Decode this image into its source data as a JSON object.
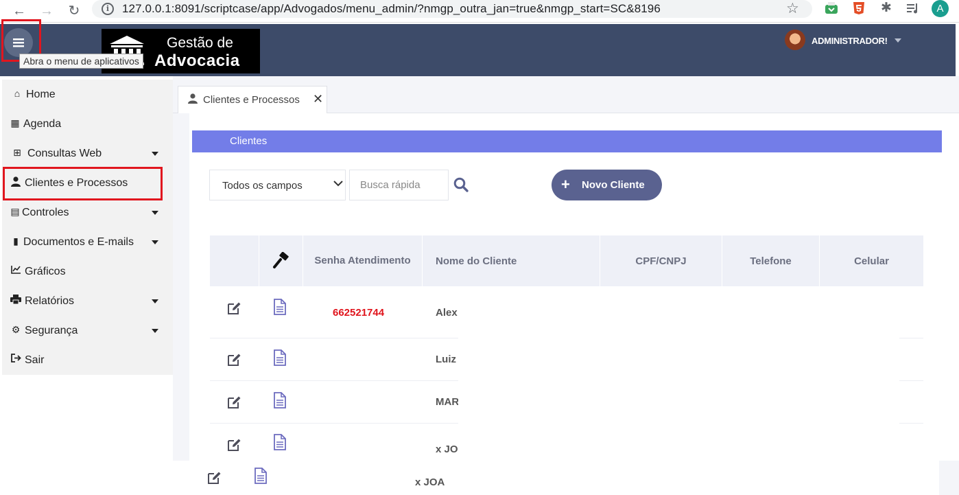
{
  "browser": {
    "back_icon": "←",
    "forward_icon": "→",
    "reload_icon": "↻",
    "url": "127.0.0.1:8091/scriptcase/app/Advogados/menu_admin/?nmgp_outra_jan=true&nmgp_start=SC&8196",
    "star_icon": "☆",
    "profile_letter": "A"
  },
  "header": {
    "menu_tooltip": "Abra o menu de aplicativos",
    "logo_line1": "Gestão de",
    "logo_line2": "Advocacia",
    "user_name": "ADMINISTRADOR!"
  },
  "sidebar": {
    "items": [
      {
        "label": "Home"
      },
      {
        "label": "Agenda"
      },
      {
        "label": "Consultas Web"
      },
      {
        "label": "Clientes e Processos"
      },
      {
        "label": "Controles"
      },
      {
        "label": "Documentos e E-mails"
      },
      {
        "label": "Gráficos"
      },
      {
        "label": "Relatórios"
      },
      {
        "label": "Segurança"
      },
      {
        "label": "Sair"
      }
    ]
  },
  "tabs": [
    {
      "label": "Clientes e Processos"
    }
  ],
  "section": {
    "title": "Clientes"
  },
  "filters": {
    "field_select": "Todos os campos",
    "search_placeholder": "Busca rápida",
    "new_button": "Novo Cliente"
  },
  "table": {
    "columns": [
      "Senha Atendimento",
      "Nome do Cliente",
      "CPF/CNPJ",
      "Telefone",
      "Celular"
    ],
    "rows": [
      {
        "senha": "662521744",
        "nome": "Alex"
      },
      {
        "senha": "",
        "nome": "Luiz A"
      },
      {
        "senha": "",
        "nome": "MAR"
      },
      {
        "senha": "",
        "nome": "x JOA"
      },
      {
        "senha": "",
        "nome": "x JOA"
      }
    ]
  },
  "colors": {
    "header_bg": "#3d4b69",
    "section_bar": "#737de8",
    "button_bg": "#5a6290",
    "highlight_red": "#e1161e",
    "senha_red": "#e0141c",
    "icon_purple": "#6c6bbf"
  }
}
